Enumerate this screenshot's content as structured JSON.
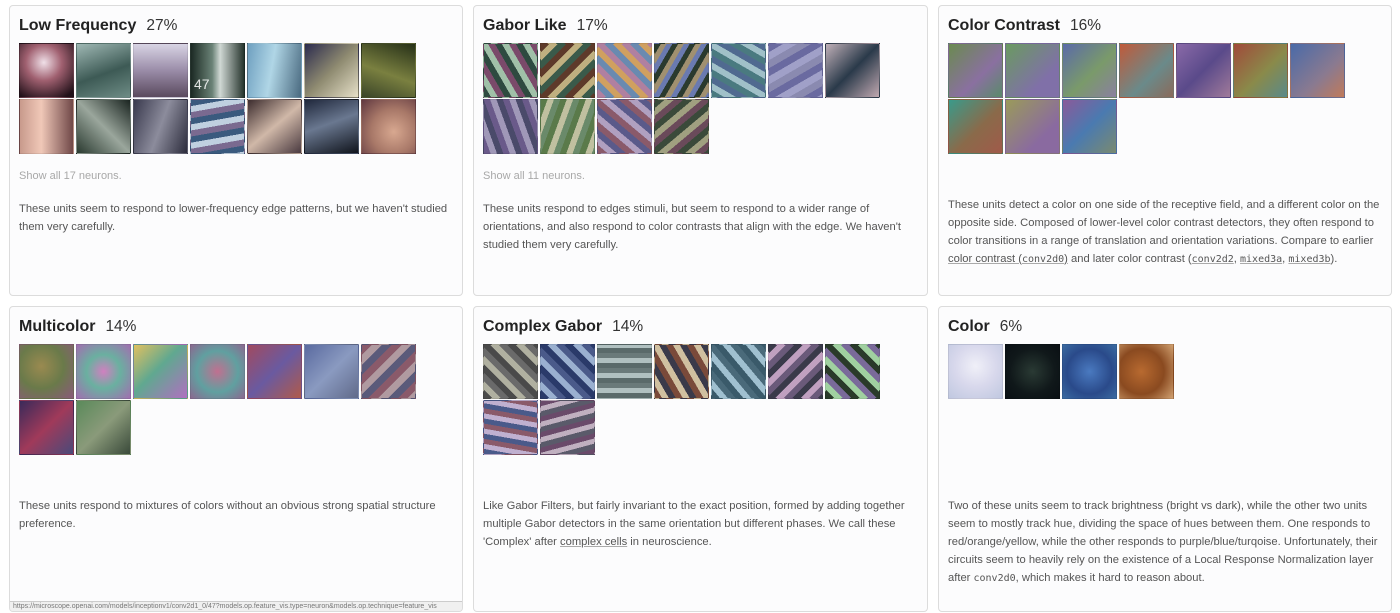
{
  "cards": [
    {
      "title": "Low Frequency",
      "pct": "27%",
      "show_all": "Show all 17 neurons.",
      "desc_text": "These units seem to respond to lower-frequency edge patterns, but we haven't studied them very carefully.",
      "thumb_label": "47",
      "thumbs": [
        "low-freq-1",
        "low-freq-2",
        "low-freq-3",
        "low-freq-4",
        "low-freq-5",
        "low-freq-6",
        "low-freq-7",
        "low-freq-8",
        "low-freq-9",
        "low-freq-10",
        "low-freq-11",
        "low-freq-12",
        "low-freq-13",
        "low-freq-14"
      ]
    },
    {
      "title": "Gabor Like",
      "pct": "17%",
      "show_all": "Show all 11 neurons.",
      "desc_text": "These units respond to edges stimuli, but seem to respond to a wider range of orientations, and also respond to color contrasts that align with the edge. We haven't studied them very carefully.",
      "thumbs": [
        "gabor-1",
        "gabor-2",
        "gabor-3",
        "gabor-4",
        "gabor-5",
        "gabor-6",
        "gabor-7",
        "gabor-8",
        "gabor-9",
        "gabor-10",
        "gabor-11"
      ]
    },
    {
      "title": "Color Contrast",
      "pct": "16%",
      "desc_parts": {
        "p1": "These units detect a color on one side of the receptive field, and a different color on the opposite side. Composed of lower-level color contrast detectors, they often respond to color transitions in a range of translation and orientation variations. Compare to earlier ",
        "link1": "color contrast (",
        "code1": "conv2d0",
        "link1_end": ")",
        "p2": " and later color contrast (",
        "code2": "conv2d2",
        "sep1": ", ",
        "code3": "mixed3a",
        "sep2": ", ",
        "code4": "mixed3b",
        "p3": ")."
      },
      "thumbs": [
        "cc-1",
        "cc-2",
        "cc-3",
        "cc-4",
        "cc-5",
        "cc-6",
        "cc-7",
        "cc-8",
        "cc-9",
        "cc-10"
      ]
    },
    {
      "title": "Multicolor",
      "pct": "14%",
      "desc_text": "These units respond to mixtures of colors without an obvious strong spatial structure preference.",
      "thumbs": [
        "multi-1",
        "multi-2",
        "multi-3",
        "multi-4",
        "multi-5",
        "multi-6",
        "multi-7",
        "multi-8",
        "multi-9"
      ]
    },
    {
      "title": "Complex Gabor",
      "pct": "14%",
      "desc_parts": {
        "p1": "Like Gabor Filters, but fairly invariant to the exact position, formed by adding together multiple Gabor detectors in the same orientation but different phases. We call these 'Complex' after ",
        "link": "complex cells",
        "p2": " in neuroscience."
      },
      "thumbs": [
        "cgabor-1",
        "cgabor-2",
        "cgabor-3",
        "cgabor-4",
        "cgabor-5",
        "cgabor-6",
        "cgabor-7",
        "cgabor-8",
        "cgabor-9"
      ]
    },
    {
      "title": "Color",
      "pct": "6%",
      "desc_parts": {
        "p1": "Two of these units seem to track brightness (bright vs dark), while the other two units seem to mostly track hue, dividing the space of hues between them. One responds to red/orange/yellow, while the other responds to purple/blue/turqoise. Unfortunately, their circuits seem to heavily rely on the existence of a Local Response Normalization layer after ",
        "code": "conv2d0",
        "p2": ", which makes it hard to reason about."
      },
      "thumbs": [
        "color-1",
        "color-2",
        "color-3",
        "color-4"
      ]
    }
  ],
  "status_bar": "https://microscope.openai.com/models/inceptionv1/conv2d1_0/47?models.op.feature_vis.type=neuron&models.op.technique=feature_vis"
}
